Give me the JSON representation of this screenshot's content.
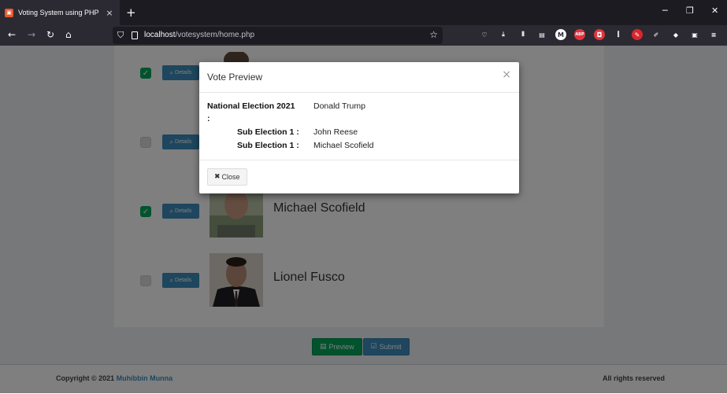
{
  "browser": {
    "tab_title": "Voting System using PHP",
    "tab_close": "×",
    "new_tab": "+",
    "url_host": "localhost",
    "url_path": "/votesystem/home.php",
    "win_minimize": "─",
    "win_restore": "❐",
    "win_close": "✕",
    "extensions": [
      {
        "name": "pocket-icon",
        "glyph": "♡",
        "color": "#2b2a33"
      },
      {
        "name": "download-icon",
        "glyph": "⤓",
        "color": "#2b2a33"
      },
      {
        "name": "library-icon",
        "glyph": "⫴",
        "color": "#2b2a33"
      },
      {
        "name": "reader-view-icon",
        "glyph": "▤",
        "color": "#2b2a33"
      },
      {
        "name": "m-extension-icon",
        "glyph": "M",
        "color": "#ffffff"
      },
      {
        "name": "adblock-icon",
        "glyph": "ABP",
        "color": "#e0353b"
      },
      {
        "name": "screenshot-icon",
        "glyph": "◘",
        "color": "#e0353b"
      },
      {
        "name": "equalizer-icon",
        "glyph": "⫿",
        "color": "#2b2a33"
      },
      {
        "name": "pdf-icon",
        "glyph": "✎",
        "color": "#d9262c"
      },
      {
        "name": "pen-icon",
        "glyph": "✐",
        "color": "#2b2a33"
      },
      {
        "name": "color-picker-icon",
        "glyph": "◆",
        "color": "#2b2a33"
      },
      {
        "name": "container-icon",
        "glyph": "▣",
        "color": "#2b2a33"
      },
      {
        "name": "menu-icon",
        "glyph": "≡",
        "color": "#2b2a33"
      }
    ]
  },
  "candidates": [
    {
      "checked": true,
      "details_label": "Details",
      "name": ""
    },
    {
      "checked": false,
      "details_label": "Details",
      "name": ""
    },
    {
      "checked": true,
      "details_label": "Details",
      "name": "Michael Scofield"
    },
    {
      "checked": false,
      "details_label": "Details",
      "name": "Lionel Fusco"
    }
  ],
  "actions": {
    "preview_label": "Preview",
    "submit_label": "Submit"
  },
  "footer": {
    "copyright": "Copyright © 2021 ",
    "author": "Muhibbin Munna",
    "rights": "All rights reserved"
  },
  "modal": {
    "title": "Vote Preview",
    "close_x": "×",
    "rows": [
      {
        "label": "National Election 2021",
        "label_suffix": ":",
        "value": "Donald Trump"
      },
      {
        "label": "Sub Election 1 :",
        "value": "John Reese"
      },
      {
        "label": "Sub Election 1 :",
        "value": "Michael Scofield"
      }
    ],
    "close_label": "Close"
  },
  "colors": {
    "primary": "#3c8dbc",
    "success": "#00a65a",
    "overlay": "rgba(0,0,0,0.5)"
  }
}
